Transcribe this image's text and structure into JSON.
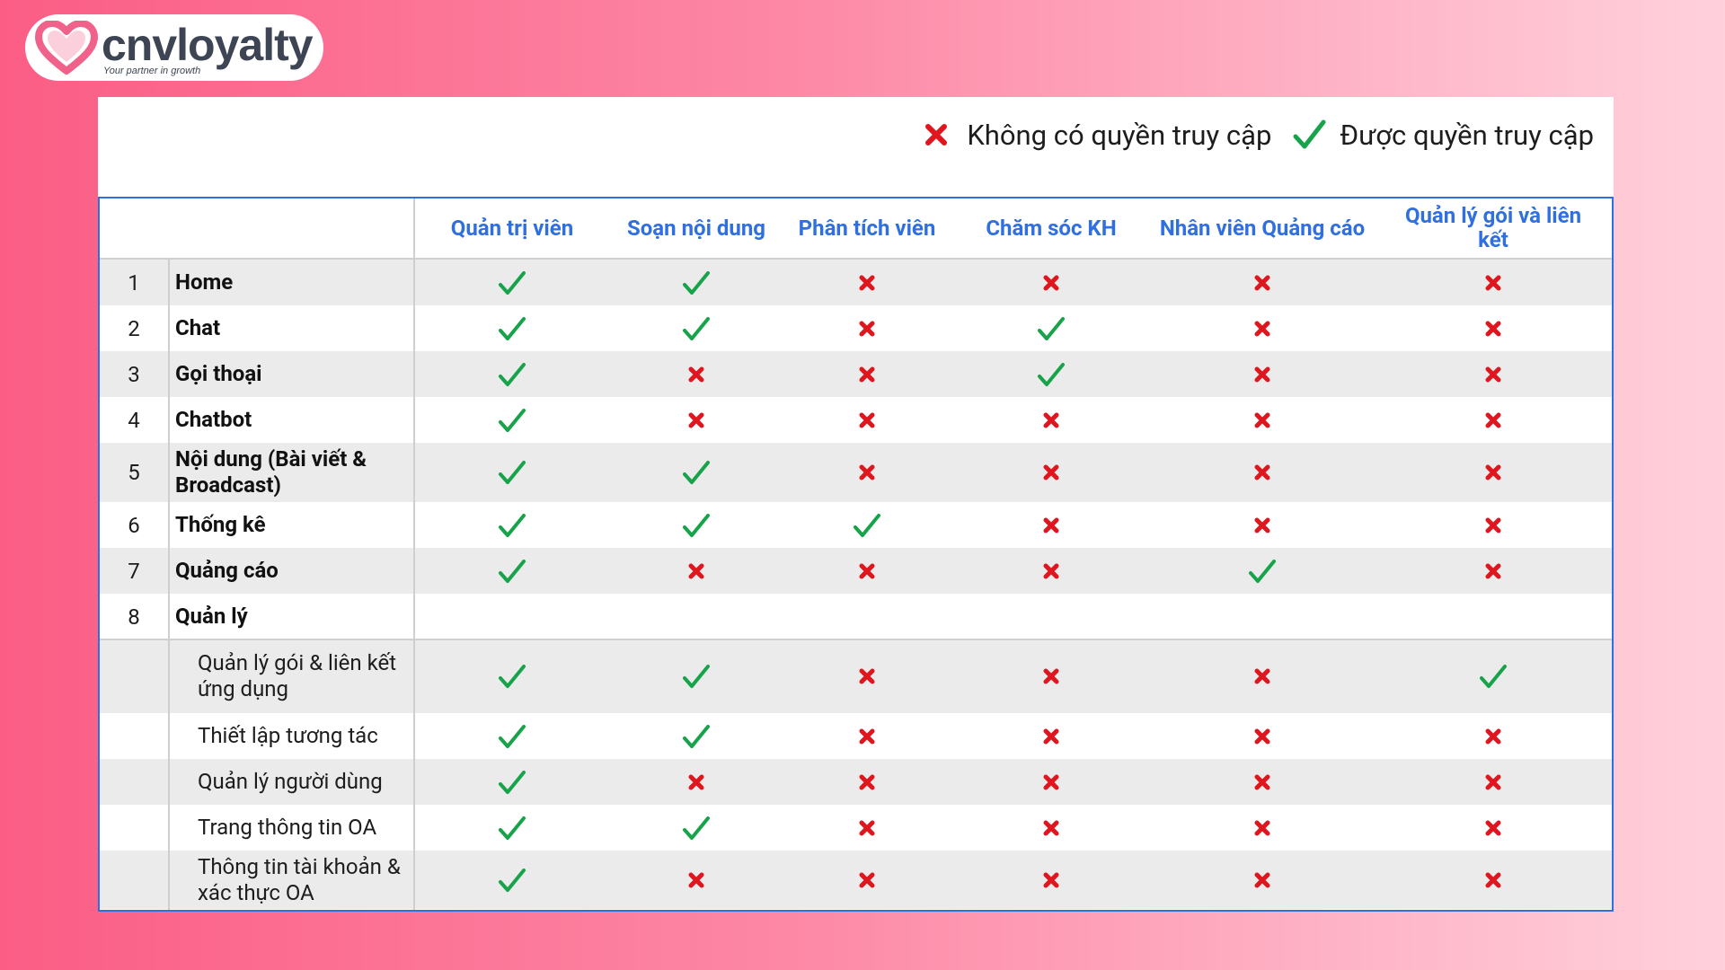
{
  "logo": {
    "brand": "cnvloyalty",
    "tagline": "Your partner in growth",
    "icon": "heart-icon",
    "color": "#fb5d85"
  },
  "legend": {
    "deny_icon": "cross-icon",
    "deny_label": "Không có quyền truy cập",
    "allow_icon": "check-icon",
    "allow_label": "Được quyền truy cập"
  },
  "colors": {
    "header_text": "#2f6fe0",
    "border": "#2f6fe0",
    "check": "#17a34a",
    "cross": "#e0161e",
    "row_shade": "#ebebeb"
  },
  "table": {
    "columns": [
      "Quản trị viên",
      "Soạn nội dung",
      "Phân tích viên",
      "Chăm sóc KH",
      "Nhân viên Quảng cáo",
      "Quản lý gói và liên kết"
    ],
    "rows": [
      {
        "num": "1",
        "name": "Home",
        "perms": [
          true,
          true,
          false,
          false,
          false,
          false
        ]
      },
      {
        "num": "2",
        "name": "Chat",
        "perms": [
          true,
          true,
          false,
          true,
          false,
          false
        ]
      },
      {
        "num": "3",
        "name": "Gọi thoại",
        "perms": [
          true,
          false,
          false,
          true,
          false,
          false
        ]
      },
      {
        "num": "4",
        "name": "Chatbot",
        "perms": [
          true,
          false,
          false,
          false,
          false,
          false
        ]
      },
      {
        "num": "5",
        "name": "Nội dung (Bài viết & Broadcast)",
        "perms": [
          true,
          true,
          false,
          false,
          false,
          false
        ]
      },
      {
        "num": "6",
        "name": "Thống kê",
        "perms": [
          true,
          true,
          true,
          false,
          false,
          false
        ]
      },
      {
        "num": "7",
        "name": "Quảng cáo",
        "perms": [
          true,
          false,
          false,
          false,
          true,
          false
        ]
      },
      {
        "num": "8",
        "name": "Quản lý",
        "perms": null
      }
    ],
    "subrows": [
      {
        "name": "Quản lý gói & liên kết ứng dụng",
        "perms": [
          true,
          true,
          false,
          false,
          false,
          true
        ]
      },
      {
        "name": "Thiết lập tương tác",
        "perms": [
          true,
          true,
          false,
          false,
          false,
          false
        ]
      },
      {
        "name": "Quản lý người dùng",
        "perms": [
          true,
          false,
          false,
          false,
          false,
          false
        ]
      },
      {
        "name": "Trang thông tin OA",
        "perms": [
          true,
          true,
          false,
          false,
          false,
          false
        ]
      },
      {
        "name": "Thông tin tài khoản & xác thực OA",
        "perms": [
          true,
          false,
          false,
          false,
          false,
          false
        ]
      }
    ]
  }
}
